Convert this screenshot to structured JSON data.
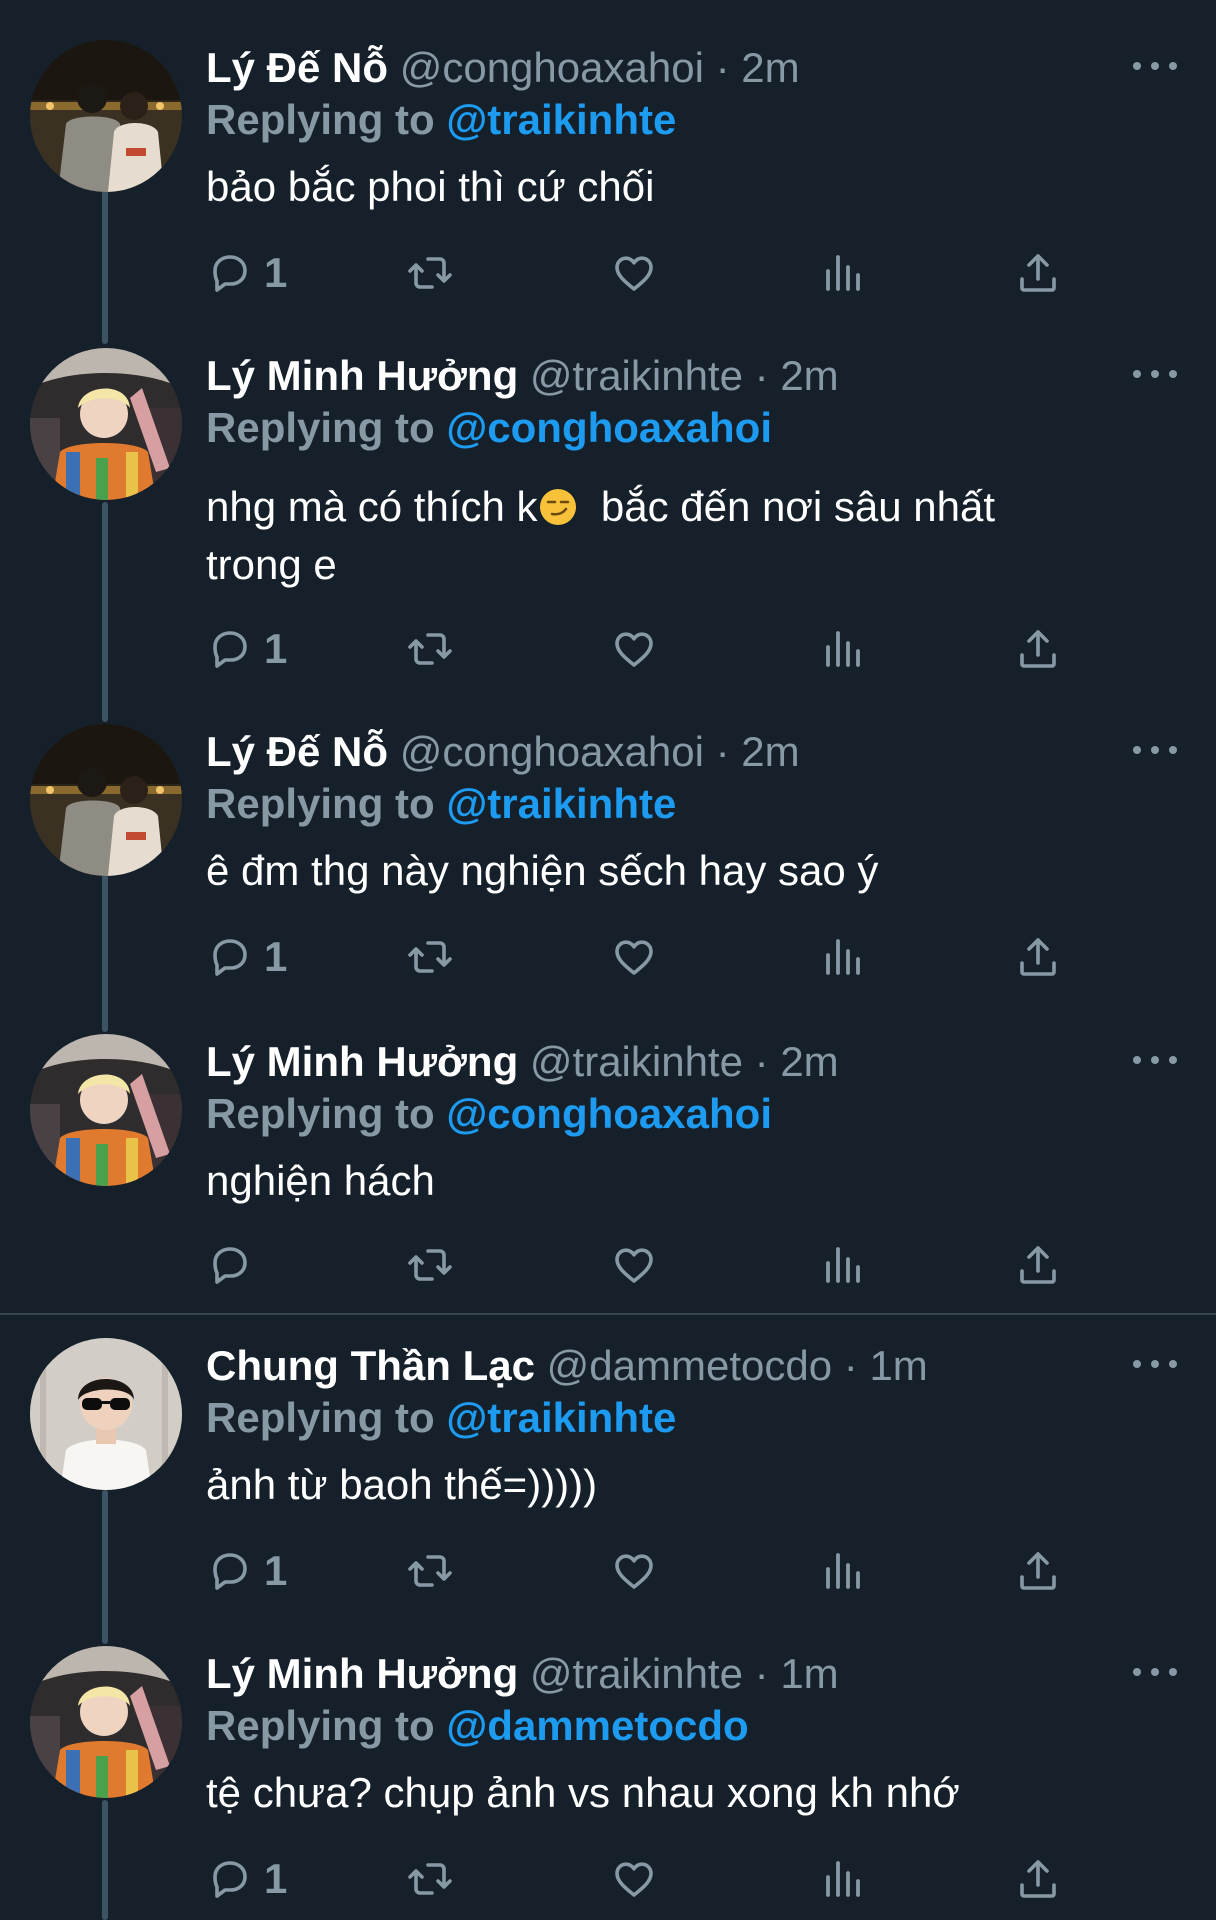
{
  "tweets": [
    {
      "name": "Lý Đế Nỗ",
      "handle": "@conghoaxahoi",
      "separator": "·",
      "time": "2m",
      "reply_prefix": "Replying to",
      "reply_to": "@traikinhte",
      "text": "bảo bắc phoi thì cứ chối",
      "reply_count": "1",
      "avatar": "avatar-de-no"
    },
    {
      "name": "Lý Minh Hưởng",
      "handle": "@traikinhte",
      "separator": "·",
      "time": "2m",
      "reply_prefix": "Replying to",
      "reply_to": "@conghoaxahoi",
      "text_before_emoji": "nhg mà có thích k",
      "emoji": "smirking-face-emoji",
      "text_after_emoji": "  bắc đến nơi sâu nhất trong e",
      "reply_count": "1",
      "avatar": "avatar-minh-huong"
    },
    {
      "name": "Lý Đế Nỗ",
      "handle": "@conghoaxahoi",
      "separator": "·",
      "time": "2m",
      "reply_prefix": "Replying to",
      "reply_to": "@traikinhte",
      "text": "ê đm thg này nghiện sếch hay sao ý",
      "reply_count": "1",
      "avatar": "avatar-de-no"
    },
    {
      "name": "Lý Minh Hưởng",
      "handle": "@traikinhte",
      "separator": "·",
      "time": "2m",
      "reply_prefix": "Replying to",
      "reply_to": "@conghoaxahoi",
      "text": "nghiện hách",
      "reply_count": "",
      "avatar": "avatar-minh-huong"
    },
    {
      "name": "Chung Thần Lạc",
      "handle": "@dammetocdo",
      "separator": "·",
      "time": "1m",
      "reply_prefix": "Replying to",
      "reply_to": "@traikinhte",
      "text": "ảnh từ baoh thế=)))))",
      "reply_count": "1",
      "avatar": "avatar-than-lac"
    },
    {
      "name": "Lý Minh Hưởng",
      "handle": "@traikinhte",
      "separator": "·",
      "time": "1m",
      "reply_prefix": "Replying to",
      "reply_to": "@dammetocdo",
      "text": "tệ chưa? chụp ảnh vs nhau xong kh nhớ",
      "reply_count": "1",
      "avatar": "avatar-minh-huong"
    }
  ],
  "icons": {
    "reply": "reply-icon",
    "retweet": "retweet-icon",
    "like": "heart-icon",
    "views": "views-icon",
    "share": "share-icon",
    "more": "more-icon"
  },
  "colors": {
    "background": "#15202b",
    "accent": "#1d9bf0",
    "muted": "#8899a6",
    "thread_line": "#3d5466"
  }
}
